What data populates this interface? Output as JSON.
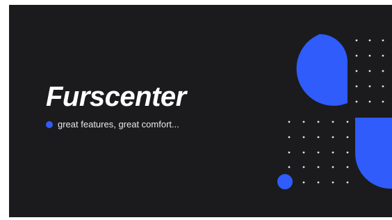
{
  "brand": {
    "title": "Furscenter",
    "tagline": "great features, great comfort..."
  },
  "colors": {
    "background": "#1b1b1d",
    "accent": "#2f5cfb",
    "text": "#ffffff",
    "dots": "#dfe3ea"
  },
  "icons": {
    "tagline_bullet": "bullet-dot-icon"
  }
}
